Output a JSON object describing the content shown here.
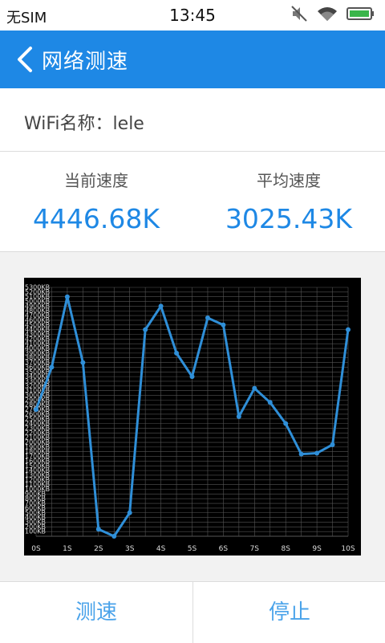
{
  "status_bar": {
    "carrier": "无SIM",
    "time": "13:45",
    "icons": [
      "mute-icon",
      "wifi-icon",
      "battery-icon"
    ]
  },
  "header": {
    "title": "网络测速",
    "back_icon": "chevron-left-icon",
    "color": "#1e88e5"
  },
  "wifi": {
    "label": "WiFi名称：lele"
  },
  "speeds": {
    "current_label": "当前速度",
    "current_value": "4446.68K",
    "average_label": "平均速度",
    "average_value": "3025.43K",
    "value_color": "#1e88e5"
  },
  "buttons": {
    "test_label": "测速",
    "stop_label": "停止"
  },
  "chart_data": {
    "type": "line",
    "title": "",
    "xlabel": "",
    "ylabel": "",
    "x_ticks": [
      "0S",
      "1S",
      "2S",
      "3S",
      "4S",
      "5S",
      "6S",
      "7S",
      "8S",
      "9S",
      "10S"
    ],
    "y_ticks": [
      "100KB",
      "200KB",
      "300KB",
      "400KB",
      "500KB",
      "600KB",
      "700KB",
      "800KB",
      "900KB",
      "1000KB",
      "1100KB",
      "1200KB",
      "1300KB",
      "1400KB",
      "1500KB",
      "1600KB",
      "1700KB",
      "1800KB",
      "1900KB",
      "2000KB",
      "2100KB",
      "2200KB",
      "2300KB",
      "2400KB",
      "2500KB",
      "2600KB",
      "2700KB",
      "2800KB",
      "2900KB",
      "3000KB",
      "3100KB",
      "3200KB",
      "3300KB",
      "3400KB",
      "3500KB",
      "3600KB",
      "3700KB",
      "3800KB",
      "3900KB",
      "4000KB",
      "4100KB",
      "4200KB",
      "4300KB",
      "4400KB",
      "4500KB",
      "4600KB",
      "4700KB",
      "4800KB",
      "4900KB",
      "5000KB",
      "5100KB",
      "5200KB",
      "5300KB"
    ],
    "xlim": [
      0,
      10
    ],
    "ylim": [
      0,
      5300
    ],
    "grid": true,
    "line_color": "#2f8fd8",
    "x": [
      0,
      0.5,
      1.0,
      1.5,
      2.0,
      2.5,
      3.0,
      3.5,
      4.0,
      4.5,
      5.0,
      5.5,
      6.0,
      6.5,
      7.0,
      7.5,
      8.0,
      8.5,
      9.0,
      9.5,
      10.0
    ],
    "y": [
      2700,
      3600,
      5100,
      3700,
      150,
      0,
      500,
      4400,
      4900,
      3900,
      3400,
      4650,
      4500,
      2550,
      3150,
      2850,
      2400,
      1750,
      1770,
      1950,
      4400
    ]
  }
}
